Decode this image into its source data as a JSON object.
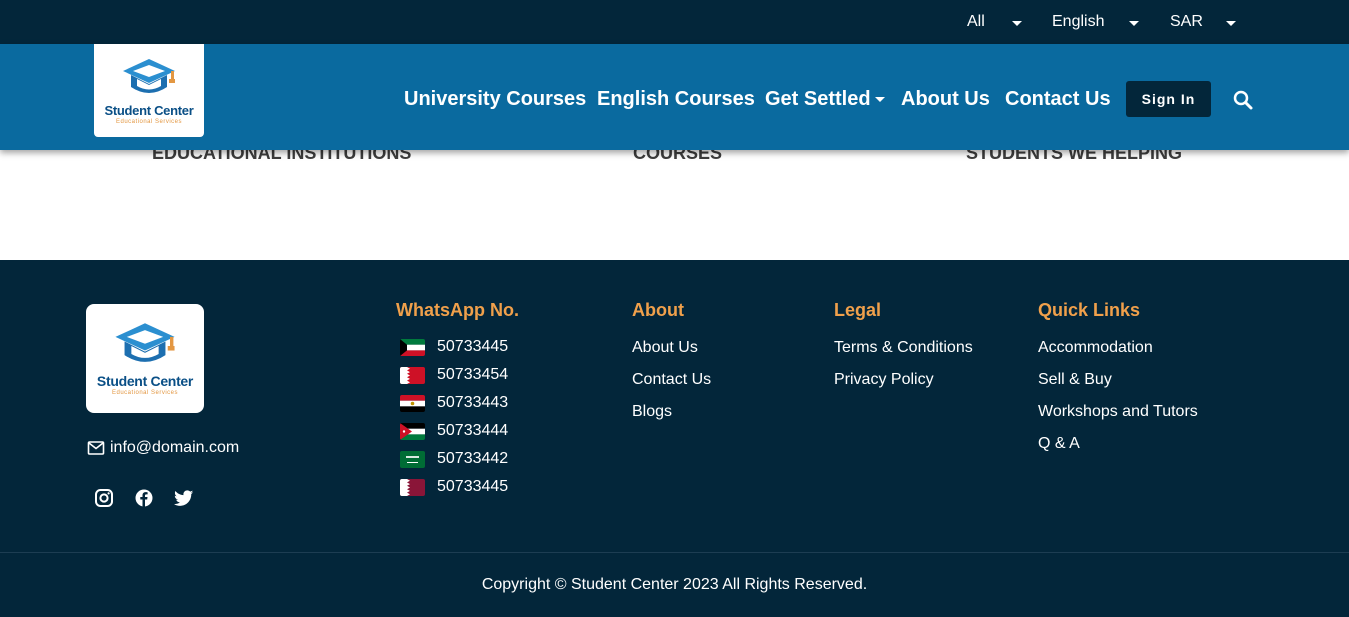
{
  "topbar": {
    "category_select": "All",
    "language_select": "English",
    "currency_select": "SAR"
  },
  "brand": {
    "name": "Student Center",
    "tagline": "Educational Services"
  },
  "nav": {
    "links": [
      "University Courses",
      "English Courses",
      "Get Settled",
      "About Us",
      "Contact Us"
    ],
    "signin_label": "Sign In"
  },
  "stats": {
    "labels": [
      "EDUCATIONAL INSTITUTIONS",
      "COURSES",
      "STUDENTS WE HELPING"
    ]
  },
  "footer": {
    "email": "info@domain.com",
    "social": [
      "instagram-icon",
      "facebook-icon",
      "twitter-icon"
    ],
    "whatsapp": {
      "title": "WhatsApp No.",
      "numbers": [
        {
          "country": "kuwait",
          "number": "50733445"
        },
        {
          "country": "bahrain",
          "number": "50733454"
        },
        {
          "country": "egypt",
          "number": "50733443"
        },
        {
          "country": "jordan",
          "number": "50733444"
        },
        {
          "country": "saudi-arabia",
          "number": "50733442"
        },
        {
          "country": "qatar",
          "number": "50733445"
        }
      ]
    },
    "about": {
      "title": "About",
      "links": [
        "About Us",
        "Contact Us",
        "Blogs"
      ]
    },
    "legal": {
      "title": "Legal",
      "links": [
        "Terms & Conditions",
        "Privacy Policy"
      ]
    },
    "quick_links": {
      "title": "Quick Links",
      "links": [
        "Accommodation",
        "Sell & Buy",
        "Workshops and Tutors",
        "Q & A"
      ]
    },
    "copyright": "Copyright © Student Center 2023 All Rights Reserved."
  },
  "colors": {
    "topbar_bg": "#03263a",
    "nav_bg": "#0a6a9f",
    "footer_bg": "#03263a",
    "accent": "#f0a04b",
    "button_bg": "#03263a"
  }
}
